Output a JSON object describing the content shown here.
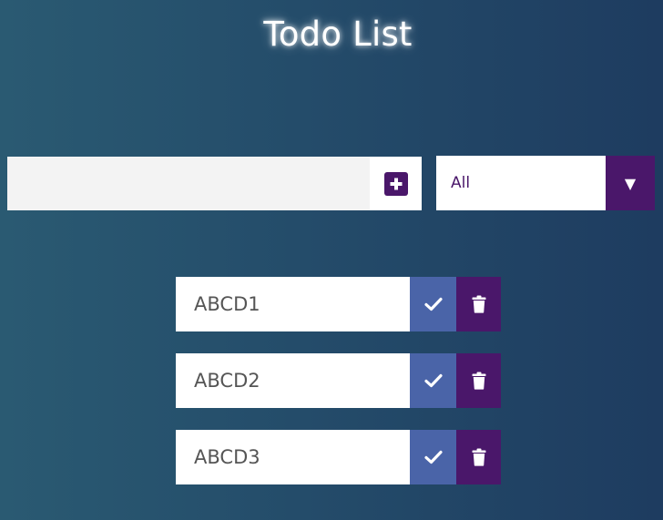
{
  "app": {
    "title": "Todo List"
  },
  "form": {
    "input_value": "",
    "input_placeholder": "",
    "add_icon": "plus-square-icon"
  },
  "filter": {
    "selected": "All",
    "arrow_glyph": "▼"
  },
  "todos": [
    {
      "text": "ABCD1"
    },
    {
      "text": "ABCD2"
    },
    {
      "text": "ABCD3"
    }
  ],
  "icons": {
    "complete": "check-icon",
    "delete": "trash-icon"
  },
  "colors": {
    "accent_purple": "#4a176a",
    "complete_blue": "#4a64a8",
    "input_bg": "#f3f3f3"
  }
}
